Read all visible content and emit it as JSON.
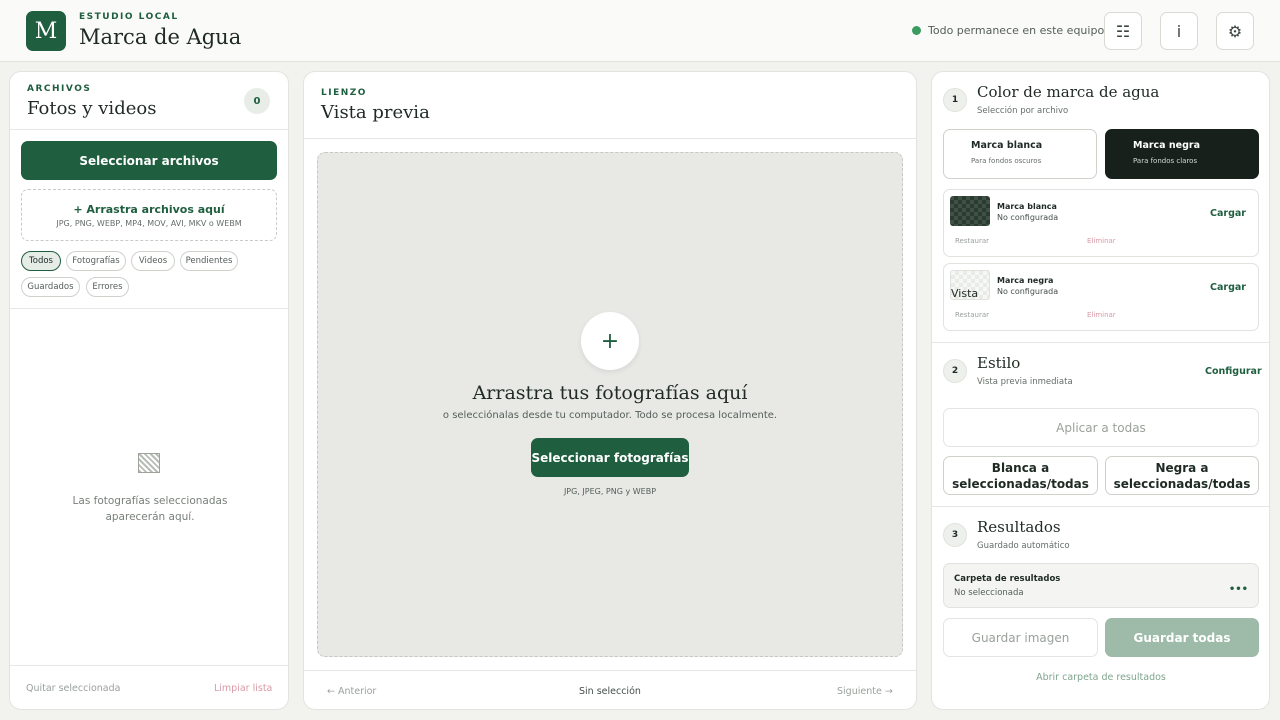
{
  "header": {
    "logo_letter": "M",
    "subtitle": "ESTUDIO LOCAL",
    "title": "Marca de Agua",
    "status": "Todo permanece en este equipo",
    "buttons": [
      "☷",
      "i",
      "⚙"
    ]
  },
  "files": {
    "eyebrow": "ARCHIVOS",
    "title": "Fotos y videos",
    "count": "0",
    "select_button": "Seleccionar archivos",
    "drop_title": "+  Arrastra archivos aquí",
    "drop_formats": "JPG, PNG, WEBP, MP4, MOV, AVI, MKV o WEBM",
    "filters": [
      "Todos",
      "Fotografías",
      "Videos",
      "Pendientes",
      "Guardados",
      "Errores"
    ],
    "empty_line1": "Las fotografías seleccionadas",
    "empty_line2": "aparecerán aquí.",
    "remove_selected": "Quitar seleccionada",
    "clear_list": "Limpiar lista"
  },
  "canvas": {
    "eyebrow": "LIENZO",
    "title": "Vista previa",
    "plus": "+",
    "drop_title": "Arrastra tus fotografías aquí",
    "drop_sub": "o selecciónalas desde tu computador. Todo se procesa localmente.",
    "select_button": "Seleccionar fotografías",
    "formats": "JPG, JPEG, PNG y WEBP",
    "prev": "← Anterior",
    "selection": "Sin selección",
    "next": "Siguiente →"
  },
  "color": {
    "step": "1",
    "title": "Color de marca de agua",
    "subtitle": "Selección por archivo",
    "white_option": {
      "title": "Marca blanca",
      "sub": "Para fondos oscuros"
    },
    "black_option": {
      "title": "Marca negra",
      "sub": "Para fondos claros"
    },
    "cards": [
      {
        "title": "Marca blanca",
        "status": "No configurada",
        "load": "Cargar",
        "restore": "Restaurar",
        "delete": "Eliminar"
      },
      {
        "title": "Marca negra",
        "status": "No configurada",
        "load": "Cargar",
        "restore": "Restaurar",
        "delete": "Eliminar",
        "thumb_alt": "Vista"
      }
    ]
  },
  "style": {
    "step": "2",
    "title": "Estilo",
    "subtitle": "Vista previa inmediata",
    "configure": "Configurar",
    "apply_all": "Aplicar a todas",
    "white_to_selected": "Blanca a seleccionadas/todas",
    "black_to_selected": "Negra a seleccionadas/todas"
  },
  "results": {
    "step": "3",
    "title": "Resultados",
    "subtitle": "Guardado automático",
    "folder_label": "Carpeta de resultados",
    "folder_value": "No seleccionada",
    "folder_menu": "•••",
    "save_image": "Guardar imagen",
    "save_all": "Guardar todas",
    "open_folder": "Abrir carpeta de resultados"
  },
  "colors": {
    "brand_green": "#1f5e3f",
    "disabled_green": "#9dbba8",
    "danger_soft": "#d99aa6",
    "status_dot": "#3c9b61"
  }
}
